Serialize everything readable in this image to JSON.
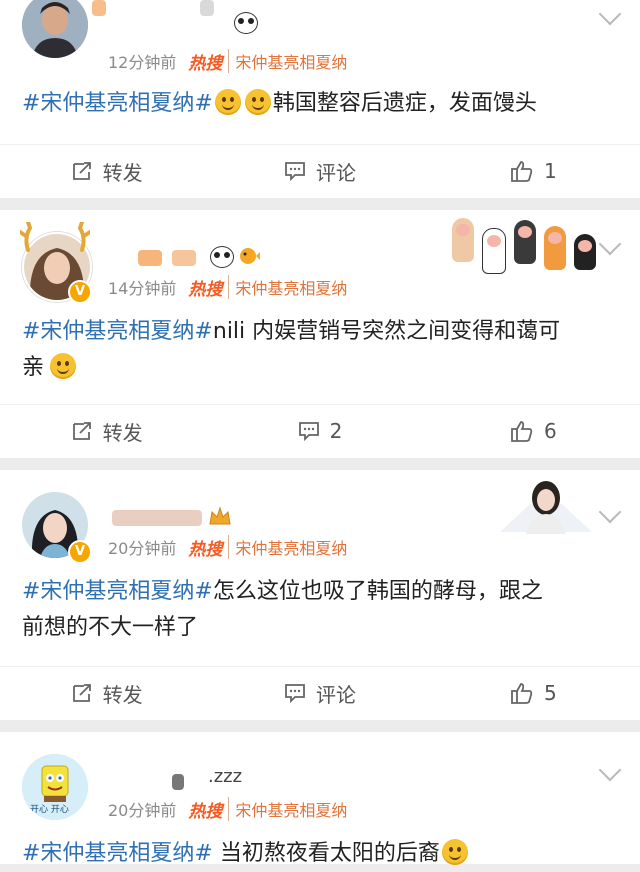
{
  "posts": [
    {
      "time": "12分钟前",
      "hot_label": "热搜",
      "topic_source": "宋仲基亮相夏纳",
      "hashtag": "#宋仲基亮相夏纳#",
      "body": "韩国整容后遗症，发面馒头",
      "repost_label": "转发",
      "comment_label": "评论",
      "like_count": "1"
    },
    {
      "time": "14分钟前",
      "hot_label": "热搜",
      "topic_source": "宋仲基亮相夏纳",
      "hashtag": "#宋仲基亮相夏纳#",
      "body_line1": "nili 内娱营销号突然之间变得和蔼可",
      "body_line2": "亲",
      "repost_label": "转发",
      "comment_count": "2",
      "like_count": "6"
    },
    {
      "time": "20分钟前",
      "hot_label": "热搜",
      "topic_source": "宋仲基亮相夏纳",
      "hashtag": "#宋仲基亮相夏纳#",
      "body_line1": "怎么这位也吸了韩国的酵母，跟之",
      "body_line2": "前想的不大一样了",
      "repost_label": "转发",
      "comment_label": "评论",
      "like_count": "5"
    },
    {
      "name_fragment": ".zzz",
      "time": "20分钟前",
      "hot_label": "热搜",
      "topic_source": "宋仲基亮相夏纳",
      "hashtag": "#宋仲基亮相夏纳#",
      "body": "当初熬夜看太阳的后裔",
      "avatar_caption": "开心 开心"
    }
  ],
  "colors": {
    "hashtag": "#2f6fb3",
    "hot": "#f55b23",
    "meta": "#8a8a8a",
    "separator": "#ececec"
  }
}
